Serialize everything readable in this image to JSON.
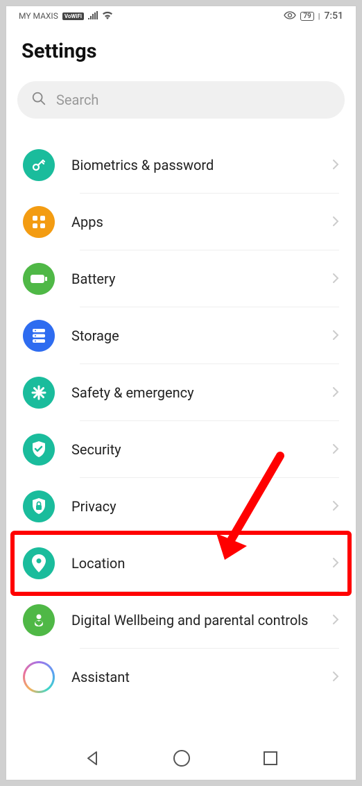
{
  "status_bar": {
    "carrier": "MY MAXIS",
    "vowifi": "VoWiFi",
    "battery": "79",
    "time": "7:51"
  },
  "page": {
    "title": "Settings"
  },
  "search": {
    "placeholder": "Search"
  },
  "items": [
    {
      "icon": "key-icon",
      "label": "Biometrics & password",
      "color": "ic-teal"
    },
    {
      "icon": "apps-icon",
      "label": "Apps",
      "color": "ic-orange"
    },
    {
      "icon": "battery-icon",
      "label": "Battery",
      "color": "ic-green"
    },
    {
      "icon": "storage-icon",
      "label": "Storage",
      "color": "ic-blue"
    },
    {
      "icon": "asterisk-icon",
      "label": "Safety & emergency",
      "color": "ic-teal"
    },
    {
      "icon": "shield-check-icon",
      "label": "Security",
      "color": "ic-teal"
    },
    {
      "icon": "lock-shield-icon",
      "label": "Privacy",
      "color": "ic-teal"
    },
    {
      "icon": "location-pin-icon",
      "label": "Location",
      "color": "ic-teal",
      "highlighted": true
    },
    {
      "icon": "heart-person-icon",
      "label": "Digital Wellbeing and parental controls",
      "color": "ic-green"
    },
    {
      "icon": "assistant-icon",
      "label": "Assistant",
      "color": "ic-gradient"
    }
  ],
  "annotation": {
    "arrow_color": "#ff0000",
    "highlight_color": "#ff0000"
  }
}
